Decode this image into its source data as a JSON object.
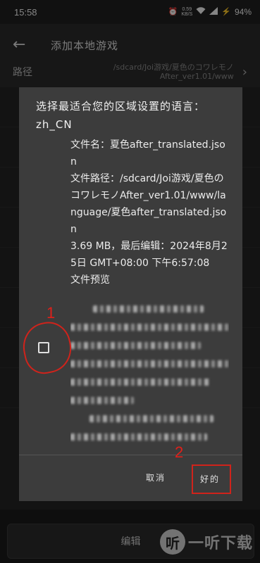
{
  "status_bar": {
    "time": "15:58",
    "net_speed_value": "0.59",
    "net_speed_unit": "KB/S",
    "battery": "94%",
    "icons": [
      "alarm-icon",
      "wifi-icon",
      "signal-icon",
      "charging-icon"
    ]
  },
  "header": {
    "title": "添加本地游戏"
  },
  "path_row": {
    "label": "路径",
    "value": "/sdcard/Joi游戏/夏色のコワレモノ After_ver1.01/www"
  },
  "bottom_bar": {
    "label": "编辑"
  },
  "watermark": {
    "logo": "听",
    "text": "一听下载"
  },
  "dialog": {
    "title": "选择最适合您的区域设置的语言：zh_CN",
    "file_name": "文件名：夏色after_translated.json",
    "file_path": "文件路径：/sdcard/Joi游戏/夏色のコワレモノAfter_ver1.01/www/language/夏色after_translated.json",
    "size_modified": "3.69 MB，最后编辑：2024年8月25日 GMT+08:00 下午6:57:08",
    "preview_label": "文件预览",
    "cancel_label": "取消",
    "ok_label": "好的"
  },
  "annotations": {
    "marker_1": "1",
    "marker_2": "2",
    "color": "#d0231b"
  }
}
